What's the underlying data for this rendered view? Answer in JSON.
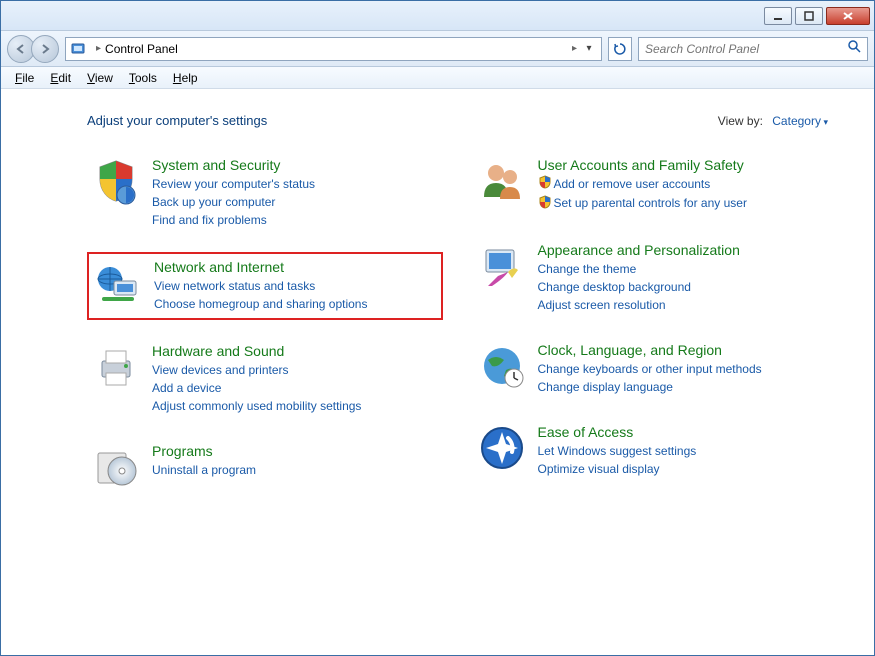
{
  "breadcrumb": {
    "root_icon_label": "Control Panel",
    "item": "Control Panel"
  },
  "search": {
    "placeholder": "Search Control Panel"
  },
  "menu": [
    "File",
    "Edit",
    "View",
    "Tools",
    "Help"
  ],
  "page_title": "Adjust your computer's settings",
  "viewby": {
    "label": "View by:",
    "value": "Category"
  },
  "left": [
    {
      "title": "System and Security",
      "highlighted": false,
      "links": [
        "Review your computer's status",
        "Back up your computer",
        "Find and fix problems"
      ],
      "icon": "shield"
    },
    {
      "title": "Network and Internet",
      "highlighted": true,
      "links": [
        "View network status and tasks",
        "Choose homegroup and sharing options"
      ],
      "icon": "network"
    },
    {
      "title": "Hardware and Sound",
      "highlighted": false,
      "links": [
        "View devices and printers",
        "Add a device",
        "Adjust commonly used mobility settings"
      ],
      "icon": "printer"
    },
    {
      "title": "Programs",
      "highlighted": false,
      "links": [
        "Uninstall a program"
      ],
      "icon": "disc"
    }
  ],
  "right": [
    {
      "title": "User Accounts and Family Safety",
      "links": [
        "Add or remove user accounts",
        "Set up parental controls for any user"
      ],
      "link_icons": [
        "shield-small",
        "shield-small"
      ],
      "icon": "users"
    },
    {
      "title": "Appearance and Personalization",
      "links": [
        "Change the theme",
        "Change desktop background",
        "Adjust screen resolution"
      ],
      "icon": "appearance"
    },
    {
      "title": "Clock, Language, and Region",
      "links": [
        "Change keyboards or other input methods",
        "Change display language"
      ],
      "icon": "globe"
    },
    {
      "title": "Ease of Access",
      "links": [
        "Let Windows suggest settings",
        "Optimize visual display"
      ],
      "icon": "ease"
    }
  ]
}
